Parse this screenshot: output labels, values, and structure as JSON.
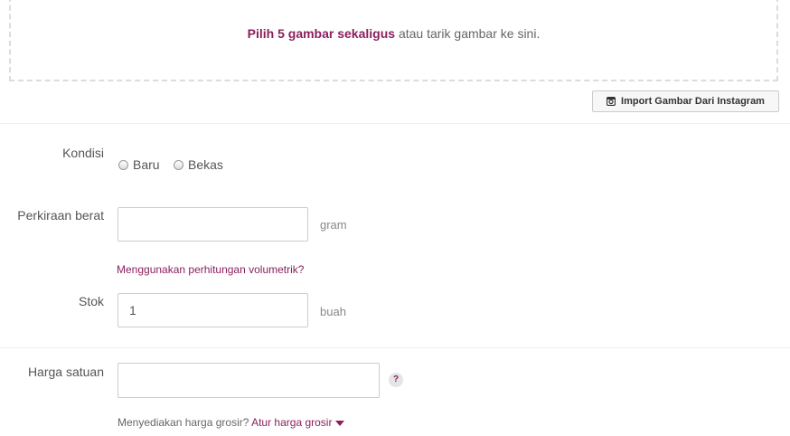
{
  "upload": {
    "pick_text": "Pilih 5 gambar sekaligus",
    "rest_text": "atau tarik gambar ke sini.",
    "instagram_button": "Import Gambar Dari Instagram"
  },
  "condition": {
    "label": "Kondisi",
    "options": [
      "Baru",
      "Bekas"
    ]
  },
  "weight": {
    "label": "Perkiraan berat",
    "value": "",
    "unit": "gram",
    "volumetric_link": "Menggunakan perhitungan volumetrik?"
  },
  "stock": {
    "label": "Stok",
    "value": "1",
    "unit": "buah"
  },
  "price": {
    "label": "Harga satuan",
    "value": "",
    "help": "?",
    "wholesale_question": "Menyediakan harga grosir?",
    "wholesale_link": "Atur harga grosir"
  },
  "colors": {
    "accent": "#8b1f5c"
  }
}
